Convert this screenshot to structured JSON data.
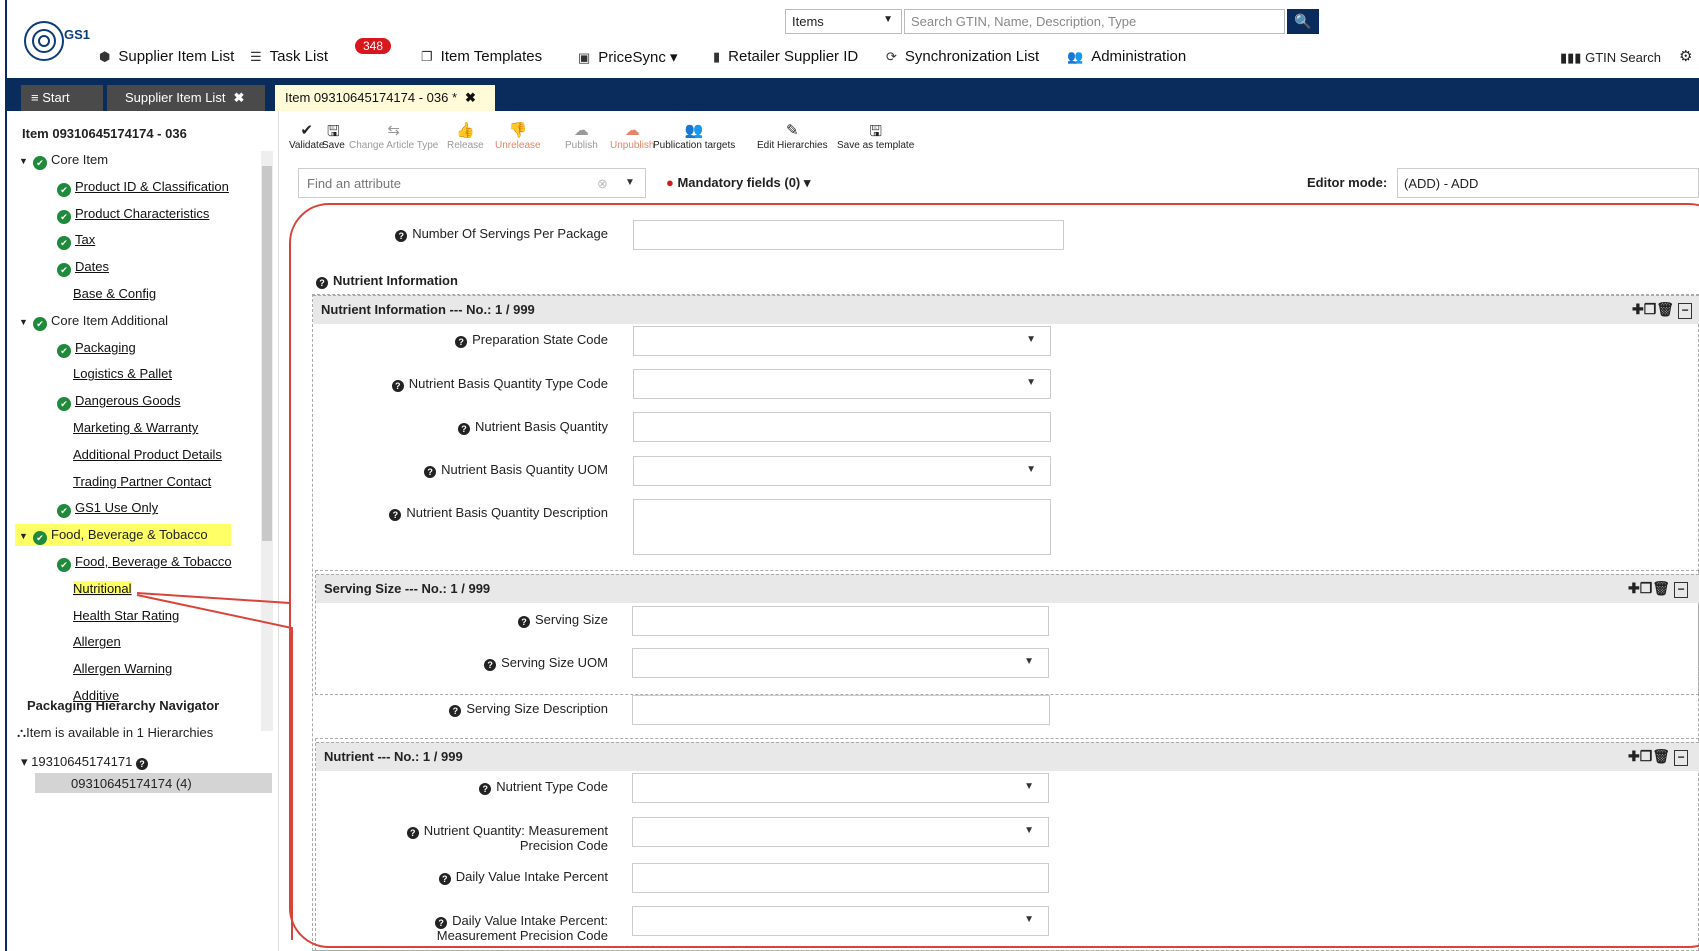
{
  "header": {
    "logo_text": "GS1",
    "nav": [
      {
        "label": "Supplier Item List",
        "icon": "cube-icon"
      },
      {
        "label": "Task List",
        "icon": "tasks-icon"
      },
      {
        "label": "Item Templates",
        "icon": "template-icon"
      },
      {
        "label": "PriceSync ▾",
        "icon": "price-icon"
      },
      {
        "label": "Retailer Supplier ID",
        "icon": "building-icon"
      },
      {
        "label": "Synchronization List",
        "icon": "sync-icon"
      },
      {
        "label": "Administration",
        "icon": "users-icon"
      }
    ],
    "task_badge": "348",
    "search_scope": "Items",
    "search_placeholder": "Search GTIN, Name, Description, Type",
    "gtin_search": "GTIN Search"
  },
  "tabs": [
    {
      "label": "Start"
    },
    {
      "label": "Supplier Item List"
    },
    {
      "label": "Item 09310645174174 - 036 *"
    }
  ],
  "left": {
    "title": "Item 09310645174174 - 036",
    "tree": [
      {
        "label": "Core Item",
        "level": 0,
        "group": true,
        "check": true
      },
      {
        "label": "Product ID & Classification",
        "level": 1,
        "check": true
      },
      {
        "label": "Product Characteristics",
        "level": 1,
        "check": true
      },
      {
        "label": "Tax",
        "level": 1,
        "check": true
      },
      {
        "label": "Dates",
        "level": 1,
        "check": true
      },
      {
        "label": "Base & Config",
        "level": 1,
        "check": false
      },
      {
        "label": "Core Item Additional",
        "level": 0,
        "group": true,
        "check": true
      },
      {
        "label": "Packaging",
        "level": 1,
        "check": true
      },
      {
        "label": "Logistics & Pallet",
        "level": 1,
        "check": false
      },
      {
        "label": "Dangerous Goods",
        "level": 1,
        "check": true
      },
      {
        "label": "Marketing & Warranty",
        "level": 1,
        "check": false
      },
      {
        "label": "Additional Product Details",
        "level": 1,
        "check": false
      },
      {
        "label": "Trading Partner Contact",
        "level": 1,
        "check": false
      },
      {
        "label": "GS1 Use Only",
        "level": 1,
        "check": true
      },
      {
        "label": "Food, Beverage & Tobacco",
        "level": 0,
        "group": true,
        "check": true,
        "highlight": true
      },
      {
        "label": "Food, Beverage & Tobacco",
        "level": 1,
        "check": true
      },
      {
        "label": "Nutritional",
        "level": 1,
        "check": false,
        "highlight": true
      },
      {
        "label": "Health Star Rating",
        "level": 1,
        "check": false
      },
      {
        "label": "Allergen",
        "level": 1,
        "check": false
      },
      {
        "label": "Allergen Warning",
        "level": 1,
        "check": false
      },
      {
        "label": "Additive",
        "level": 1,
        "check": false
      }
    ],
    "phn_title": "Packaging Hierarchy Navigator",
    "phn_info": "Item is available in 1 Hierarchies",
    "phn_node": "19310645174171",
    "phn_selected": "09310645174174 (4)"
  },
  "toolbar": {
    "buttons": [
      {
        "label": "Validate",
        "icon": "check-icon",
        "state": "on"
      },
      {
        "label": "Save",
        "icon": "save-icon",
        "state": "on"
      },
      {
        "label": "Change Article Type",
        "icon": "change-type-icon",
        "state": "dis"
      },
      {
        "label": "Release",
        "icon": "thumbs-up-icon",
        "state": "dis"
      },
      {
        "label": "Unrelease",
        "icon": "thumbs-down-icon",
        "state": "warn"
      },
      {
        "label": "Publish",
        "icon": "cloud-upload-icon",
        "state": "dis"
      },
      {
        "label": "Unpublish",
        "icon": "cloud-download-icon",
        "state": "warn"
      },
      {
        "label": "Publication targets",
        "icon": "users-icon",
        "state": "on"
      },
      {
        "label": "Edit Hierarchies",
        "icon": "pencil-icon",
        "state": "on"
      },
      {
        "label": "Save as template",
        "icon": "save-template-icon",
        "state": "on"
      }
    ],
    "find_placeholder": "Find an attribute",
    "mandatory": "Mandatory fields (0)",
    "editor_label": "Editor mode:",
    "editor_value": "(ADD) - ADD"
  },
  "form": {
    "servings_label": "Number Of Servings Per Package",
    "nutrient_info_title": "Nutrient Information",
    "nutrient_info_header": "Nutrient Information --- No.: 1 / 999",
    "prep_state": "Preparation State Code",
    "basis_qty_type": "Nutrient Basis Quantity Type Code",
    "basis_qty": "Nutrient Basis Quantity",
    "basis_qty_uom": "Nutrient Basis Quantity UOM",
    "basis_qty_desc": "Nutrient Basis Quantity Description",
    "serving_header": "Serving Size --- No.: 1 / 999",
    "serving_size": "Serving Size",
    "serving_size_uom": "Serving Size UOM",
    "serving_size_desc": "Serving Size Description",
    "nutrient_header": "Nutrient --- No.: 1 / 999",
    "nutrient_type": "Nutrient Type Code",
    "nutrient_qty_prec_1": "Nutrient Quantity: Measurement",
    "nutrient_qty_prec_2": "Precision Code",
    "dv_intake": "Daily Value Intake Percent",
    "dv_intake_prec_1": "Daily Value Intake Percent:",
    "dv_intake_prec_2": "Measurement Precision Code"
  },
  "colors": {
    "navy": "#0a2c5c",
    "highlight": "#ffff66",
    "callout": "#d9443a",
    "check": "#1f8a3c"
  }
}
